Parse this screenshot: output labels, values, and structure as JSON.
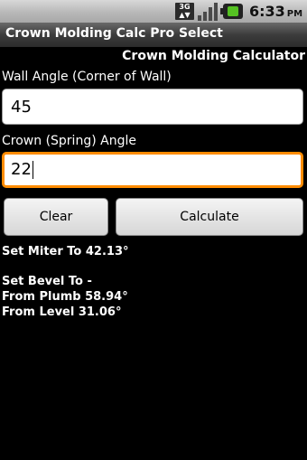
{
  "status_bar": {
    "network_icon": "3g-icon",
    "network_label": "3G",
    "signal_icon": "signal-icon",
    "battery_icon": "battery-charging-icon",
    "time": "6:33",
    "ampm": "PM"
  },
  "app": {
    "title": "Crown Molding Calc Pro Select",
    "header": "Crown Molding Calculator"
  },
  "form": {
    "wall_angle_label": "Wall Angle (Corner of Wall)",
    "wall_angle_value": "45",
    "crown_angle_label": "Crown (Spring) Angle",
    "crown_angle_value": "22"
  },
  "buttons": {
    "clear": "Clear",
    "calculate": "Calculate"
  },
  "results": {
    "miter": "Set Miter To 42.13°",
    "bevel_heading": "Set Bevel To -",
    "from_plumb": "From Plumb 58.94°",
    "from_level": "From Level 31.06°"
  },
  "colors": {
    "focus_border": "#ff8c00",
    "background": "#000000",
    "battery_accent": "#55c222"
  }
}
